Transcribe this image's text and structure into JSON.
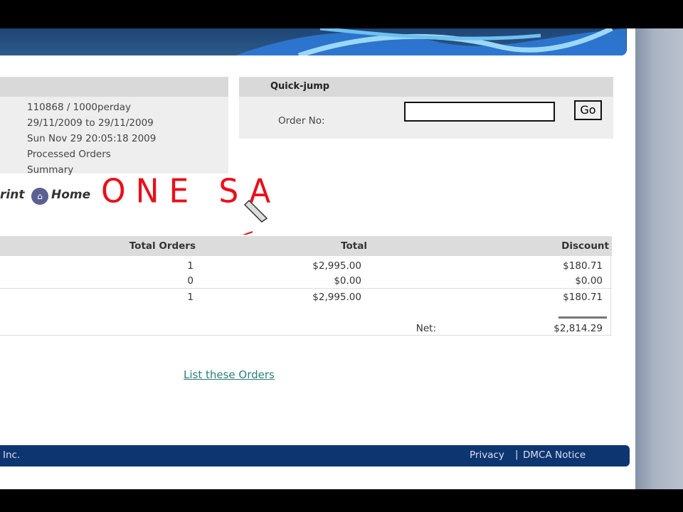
{
  "report": {
    "lines": [
      "110868 / 1000perday",
      "29/11/2009 to 29/11/2009",
      "Sun Nov 29 20:05:18 2009",
      "Processed Orders",
      "Summary"
    ]
  },
  "quickjump": {
    "title": "Quick-jump",
    "order_label": "Order No:",
    "order_value": "",
    "go": "Go"
  },
  "nav": {
    "print": "rint",
    "home": "Home"
  },
  "annotation": "ONE SA",
  "table": {
    "headers": [
      "Total Orders",
      "Total",
      "Discount"
    ],
    "rows": [
      [
        "1",
        "$2,995.00",
        "$180.71"
      ],
      [
        "0",
        "$0.00",
        "$0.00"
      ],
      [
        "1",
        "$2,995.00",
        "$180.71"
      ]
    ],
    "net_label": "Net:",
    "net_value": "$2,814.29"
  },
  "list_link": "List these Orders",
  "footer": {
    "left": "Inc.",
    "privacy": "Privacy",
    "dmca": "DMCA Notice"
  }
}
